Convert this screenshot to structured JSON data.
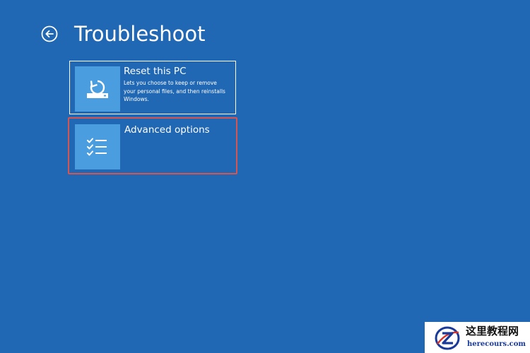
{
  "header": {
    "back_icon": "back-arrow-icon",
    "title": "Troubleshoot"
  },
  "options": [
    {
      "id": "reset",
      "icon": "reset-pc-icon",
      "title": "Reset this PC",
      "description": "Lets you choose to keep or remove your personal files, and then reinstalls Windows.",
      "highlighted": false
    },
    {
      "id": "advanced",
      "icon": "checklist-icon",
      "title": "Advanced options",
      "highlighted": true
    }
  ],
  "colors": {
    "background": "#2067b4",
    "tile": "#4a9ee0",
    "highlight_border": "#d9534f",
    "text": "#ffffff"
  },
  "watermark": {
    "name": "这里教程网",
    "url": "herecours.com"
  }
}
